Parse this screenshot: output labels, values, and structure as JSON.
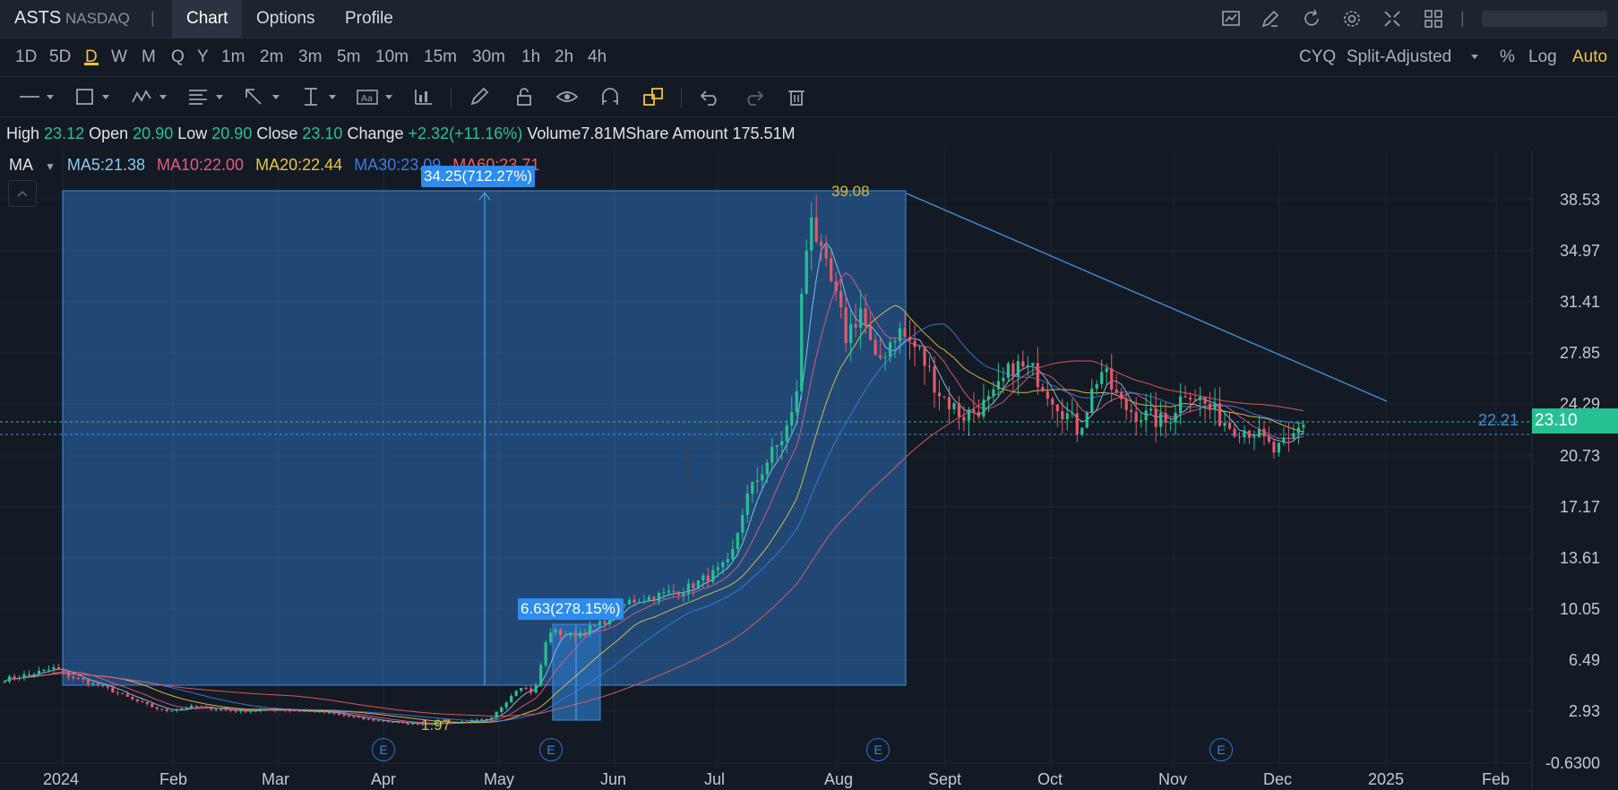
{
  "app": {
    "ticker": "ASTS",
    "exchange": "NASDAQ",
    "tabs": [
      "Chart",
      "Options",
      "Profile"
    ],
    "active_tab": "Chart"
  },
  "timeframes": [
    "1D",
    "5D",
    "D",
    "W",
    "M",
    "Q",
    "Y",
    "1m",
    "2m",
    "3m",
    "5m",
    "10m",
    "15m",
    "30m",
    "1h",
    "2h",
    "4h"
  ],
  "active_timeframe": "D",
  "chart_options": {
    "cyq": "CYQ",
    "adjust": "Split-Adjusted",
    "percent": "%",
    "log": "Log",
    "auto": "Auto"
  },
  "ohlc": {
    "high_label": "High",
    "high": "23.12",
    "open_label": "Open",
    "open": "20.90",
    "low_label": "Low",
    "low": "20.90",
    "close_label": "Close",
    "close": "23.10",
    "change_label": "Change",
    "change": "+2.32(+11.16%)",
    "volume_label": "Volume",
    "volume": "7.81M",
    "share_amount_label": "Share Amount",
    "share_amount": "175.51M"
  },
  "ma_bar": {
    "label": "MA",
    "ma5": "MA5:21.38",
    "ma10": "MA10:22.00",
    "ma20": "MA20:22.44",
    "ma30": "MA30:23.09",
    "ma60": "MA60:23.71"
  },
  "annotations": {
    "big_measure": "34.25(712.27%)",
    "small_measure": "6.63(278.15%)",
    "peak": "39.08",
    "low": "1.97",
    "earnings_marker": "E",
    "ma_value_tag": "22.21",
    "price_tag": "23.10"
  },
  "colors": {
    "up": "#27c093",
    "down": "#e05a6a",
    "ma5": "#8ec7f2",
    "ma10": "#e35b87",
    "ma20": "#e7c44a",
    "ma30": "#3b7be3",
    "ma60": "#ea5b62",
    "accent": "#f3c13a"
  },
  "chart_data": {
    "type": "candlestick",
    "y_ticks": [
      "38.53",
      "34.97",
      "31.41",
      "27.85",
      "24.29",
      "20.73",
      "17.17",
      "13.61",
      "10.05",
      "6.49",
      "2.93",
      "-0.6300"
    ],
    "x_ticks": [
      "2024",
      "Feb",
      "Mar",
      "Apr",
      "May",
      "Jun",
      "Jul",
      "Aug",
      "Sept",
      "Oct",
      "Nov",
      "Dec",
      "2025",
      "Feb"
    ],
    "ylim": [
      -0.63,
      38.53
    ],
    "close_path": [
      {
        "t": 0.0,
        "v": 5.2
      },
      {
        "t": 0.02,
        "v": 5.6
      },
      {
        "t": 0.035,
        "v": 6.0
      },
      {
        "t": 0.045,
        "v": 5.4
      },
      {
        "t": 0.07,
        "v": 4.6
      },
      {
        "t": 0.09,
        "v": 3.7
      },
      {
        "t": 0.11,
        "v": 3.0
      },
      {
        "t": 0.13,
        "v": 3.3
      },
      {
        "t": 0.16,
        "v": 3.0
      },
      {
        "t": 0.19,
        "v": 3.1
      },
      {
        "t": 0.22,
        "v": 2.9
      },
      {
        "t": 0.25,
        "v": 2.4
      },
      {
        "t": 0.28,
        "v": 2.1
      },
      {
        "t": 0.31,
        "v": 2.2
      },
      {
        "t": 0.335,
        "v": 2.4
      },
      {
        "t": 0.345,
        "v": 3.6
      },
      {
        "t": 0.355,
        "v": 4.8
      },
      {
        "t": 0.365,
        "v": 4.2
      },
      {
        "t": 0.375,
        "v": 8.6
      },
      {
        "t": 0.39,
        "v": 8.2
      },
      {
        "t": 0.41,
        "v": 9.0
      },
      {
        "t": 0.43,
        "v": 10.6
      },
      {
        "t": 0.45,
        "v": 11.0
      },
      {
        "t": 0.47,
        "v": 11.5
      },
      {
        "t": 0.49,
        "v": 12.6
      },
      {
        "t": 0.5,
        "v": 13.3
      },
      {
        "t": 0.51,
        "v": 17.5
      },
      {
        "t": 0.525,
        "v": 20.3
      },
      {
        "t": 0.535,
        "v": 21.8
      },
      {
        "t": 0.545,
        "v": 24.0
      },
      {
        "t": 0.55,
        "v": 33.0
      },
      {
        "t": 0.556,
        "v": 38.0
      },
      {
        "t": 0.562,
        "v": 34.5
      },
      {
        "t": 0.57,
        "v": 32.5
      },
      {
        "t": 0.58,
        "v": 29.0
      },
      {
        "t": 0.59,
        "v": 31.0
      },
      {
        "t": 0.6,
        "v": 27.0
      },
      {
        "t": 0.615,
        "v": 29.5
      },
      {
        "t": 0.63,
        "v": 28.0
      },
      {
        "t": 0.645,
        "v": 25.0
      },
      {
        "t": 0.66,
        "v": 23.5
      },
      {
        "t": 0.68,
        "v": 24.5
      },
      {
        "t": 0.695,
        "v": 27.0
      },
      {
        "t": 0.71,
        "v": 26.5
      },
      {
        "t": 0.725,
        "v": 24.5
      },
      {
        "t": 0.74,
        "v": 22.5
      },
      {
        "t": 0.755,
        "v": 26.8
      },
      {
        "t": 0.77,
        "v": 24.2
      },
      {
        "t": 0.785,
        "v": 23.5
      },
      {
        "t": 0.8,
        "v": 23.0
      },
      {
        "t": 0.815,
        "v": 25.5
      },
      {
        "t": 0.83,
        "v": 24.0
      },
      {
        "t": 0.845,
        "v": 22.8
      },
      {
        "t": 0.86,
        "v": 22.5
      },
      {
        "t": 0.875,
        "v": 21.0
      },
      {
        "t": 0.885,
        "v": 21.6
      },
      {
        "t": 0.895,
        "v": 23.1
      }
    ]
  }
}
